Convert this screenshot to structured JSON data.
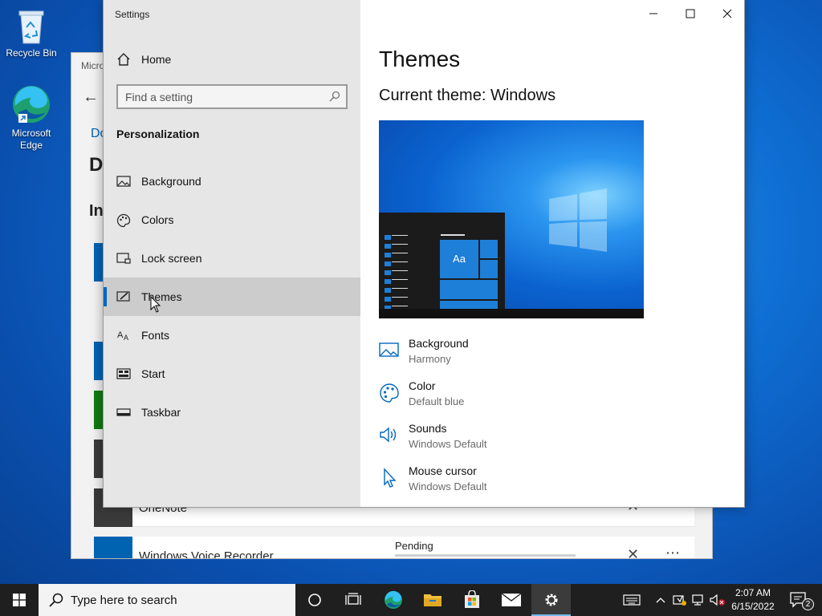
{
  "desktop": {
    "icons": [
      {
        "label": "Recycle Bin"
      },
      {
        "label": "Microsoft Edge"
      }
    ]
  },
  "background_window": {
    "title": "Micro",
    "link": "Do",
    "heading1": "D",
    "heading2": "In",
    "rows": [
      {
        "name": "OneNote",
        "tile_color": "#3a3a3a"
      },
      {
        "name": "Windows Voice Recorder",
        "tile_color": "#0063b1"
      }
    ],
    "pending": "Pending",
    "tiles": [
      "#0063b1",
      "#0063b1",
      "#107c10",
      "#3a3a3a"
    ]
  },
  "settings": {
    "app_title": "Settings",
    "home_label": "Home",
    "search_placeholder": "Find a setting",
    "section_title": "Personalization",
    "nav": [
      {
        "label": "Background",
        "icon": "picture-icon"
      },
      {
        "label": "Colors",
        "icon": "palette-icon"
      },
      {
        "label": "Lock screen",
        "icon": "lock-screen-icon"
      },
      {
        "label": "Themes",
        "icon": "themes-icon",
        "active": true
      },
      {
        "label": "Fonts",
        "icon": "fonts-icon"
      },
      {
        "label": "Start",
        "icon": "start-icon"
      },
      {
        "label": "Taskbar",
        "icon": "taskbar-icon"
      }
    ],
    "page_title": "Themes",
    "current_theme": "Current theme: Windows",
    "preview_tile_label": "Aa",
    "properties": [
      {
        "name": "Background",
        "value": "Harmony",
        "icon": "picture-icon"
      },
      {
        "name": "Color",
        "value": "Default blue",
        "icon": "palette-icon"
      },
      {
        "name": "Sounds",
        "value": "Windows Default",
        "icon": "speaker-icon"
      },
      {
        "name": "Mouse cursor",
        "value": "Windows Default",
        "icon": "cursor-icon"
      }
    ],
    "accent_color": "#0067c0"
  },
  "taskbar": {
    "search_placeholder": "Type here to search",
    "time": "2:07 AM",
    "date": "6/15/2022",
    "notification_count": "2"
  }
}
